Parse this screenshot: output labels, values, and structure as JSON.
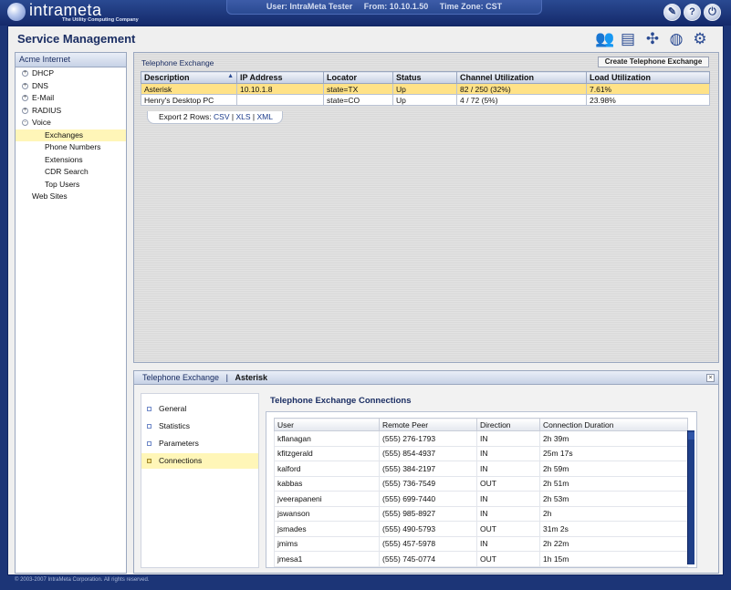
{
  "banner": {
    "logo_name": "intrameta",
    "logo_tagline": "The Utility Computing Company",
    "session": {
      "user": "User: IntraMeta Tester",
      "from": "From: 10.10.1.50",
      "timezone": "Time Zone: CST"
    },
    "icons": [
      "wrench-icon",
      "help-icon",
      "power-icon"
    ]
  },
  "page": {
    "title": "Service Management",
    "toolbar_icons": [
      "users-icon",
      "billing-icon",
      "network-icon",
      "globe-icon",
      "gears-icon"
    ]
  },
  "tree": {
    "header": "Acme Internet",
    "items": [
      {
        "label": "DHCP",
        "level": 0,
        "expander": "+",
        "selected": false
      },
      {
        "label": "DNS",
        "level": 0,
        "expander": "+",
        "selected": false
      },
      {
        "label": "E-Mail",
        "level": 0,
        "expander": "+",
        "selected": false
      },
      {
        "label": "RADIUS",
        "level": 0,
        "expander": "+",
        "selected": false
      },
      {
        "label": "Voice",
        "level": 0,
        "expander": "-",
        "selected": false
      },
      {
        "label": "Exchanges",
        "level": 1,
        "expander": "",
        "selected": true
      },
      {
        "label": "Phone Numbers",
        "level": 1,
        "expander": "",
        "selected": false
      },
      {
        "label": "Extensions",
        "level": 1,
        "expander": "",
        "selected": false
      },
      {
        "label": "CDR Search",
        "level": 1,
        "expander": "",
        "selected": false
      },
      {
        "label": "Top Users",
        "level": 1,
        "expander": "",
        "selected": false
      },
      {
        "label": "Web Sites",
        "level": 0,
        "expander": "",
        "selected": false
      }
    ]
  },
  "exchange": {
    "panel_label": "Telephone Exchange",
    "create_button": "Create Telephone Exchange",
    "columns": [
      "Description",
      "IP Address",
      "Locator",
      "Status",
      "Channel Utilization",
      "Load Utilization"
    ],
    "rows": [
      {
        "description": "Asterisk",
        "ip": "10.10.1.8",
        "locator": "state=TX",
        "status": "Up",
        "channel": "82 / 250 (32%)",
        "load": "7.61%",
        "highlighted": true
      },
      {
        "description": "Henry's Desktop PC",
        "ip": "",
        "locator": "state=CO",
        "status": "Up",
        "channel": "4 / 72 (5%)",
        "load": "23.98%",
        "highlighted": false
      }
    ],
    "export": {
      "label": "Export 2 Rows:",
      "csv": "CSV",
      "xls": "XLS",
      "xml": "XML",
      "sep": "|"
    }
  },
  "detail": {
    "breadcrumb_parent": "Telephone Exchange",
    "breadcrumb_sep": "|",
    "breadcrumb_current": "Asterisk",
    "close": "×",
    "nav": [
      {
        "label": "General",
        "active": false
      },
      {
        "label": "Statistics",
        "active": false
      },
      {
        "label": "Parameters",
        "active": false
      },
      {
        "label": "Connections",
        "active": true
      }
    ],
    "connections_title": "Telephone Exchange Connections",
    "columns": [
      "User",
      "Remote Peer",
      "Direction",
      "Connection Duration"
    ],
    "rows": [
      {
        "user": "kflanagan",
        "peer": "(555) 276-1793",
        "direction": "IN",
        "duration": "2h 39m"
      },
      {
        "user": "kfitzgerald",
        "peer": "(555) 854-4937",
        "direction": "IN",
        "duration": "25m 17s"
      },
      {
        "user": "kalford",
        "peer": "(555) 384-2197",
        "direction": "IN",
        "duration": "2h 59m"
      },
      {
        "user": "kabbas",
        "peer": "(555) 736-7549",
        "direction": "OUT",
        "duration": "2h 51m"
      },
      {
        "user": "jveerapaneni",
        "peer": "(555) 699-7440",
        "direction": "IN",
        "duration": "2h 53m"
      },
      {
        "user": "jswanson",
        "peer": "(555) 985-8927",
        "direction": "IN",
        "duration": "2h"
      },
      {
        "user": "jsmades",
        "peer": "(555) 490-5793",
        "direction": "OUT",
        "duration": "31m 2s"
      },
      {
        "user": "jmims",
        "peer": "(555) 457-5978",
        "direction": "IN",
        "duration": "2h 22m"
      },
      {
        "user": "jmesa1",
        "peer": "(555) 745-0774",
        "direction": "OUT",
        "duration": "1h 15m"
      }
    ]
  },
  "footer": "© 2003-2007 IntraMeta Corporation.  All rights reserved."
}
